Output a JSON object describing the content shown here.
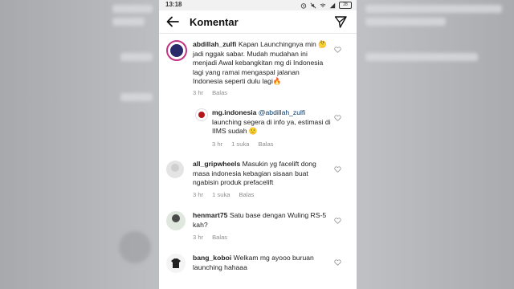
{
  "status_bar": {
    "time": "13:18",
    "battery": "28"
  },
  "header": {
    "title": "Komentar"
  },
  "comments": [
    {
      "username": "abdillah_zulfi",
      "text": "Kapan Launchingnya min 🤔 jadi nggak sabar. Mudah mudahan ini menjadi Awal kebangkitan mg di Indonesia lagi yang ramai mengaspal jalanan Indonesia seperti dulu lagi🔥",
      "time": "3 hr",
      "reply_label": "Balas",
      "replies": [
        {
          "username": "mg.indonesia",
          "mention": "@abdillah_zulfi",
          "text": "launching segera di info ya, estimasi di IIMS sudah 🙂",
          "time": "3 hr",
          "likes": "1 suka",
          "reply_label": "Balas"
        }
      ]
    },
    {
      "username": "all_gripwheels",
      "text": "Masukin yg facelift dong masa indonesia kebagian sisaan buat ngabisin produk prefacelift",
      "time": "3 hr",
      "likes": "1 suka",
      "reply_label": "Balas"
    },
    {
      "username": "henmart75",
      "text": "Satu base dengan Wuling RS-5 kah?",
      "time": "3 hr",
      "reply_label": "Balas"
    },
    {
      "username": "bang_koboi",
      "text": "Welkam mg ayooo buruan launching hahaaa"
    }
  ],
  "icons": [
    "back-arrow-icon",
    "send-icon",
    "heart-icon"
  ],
  "colors": {
    "meta_text": "#8e8e8e",
    "text": "#222222",
    "divider": "#e6e6e6"
  }
}
